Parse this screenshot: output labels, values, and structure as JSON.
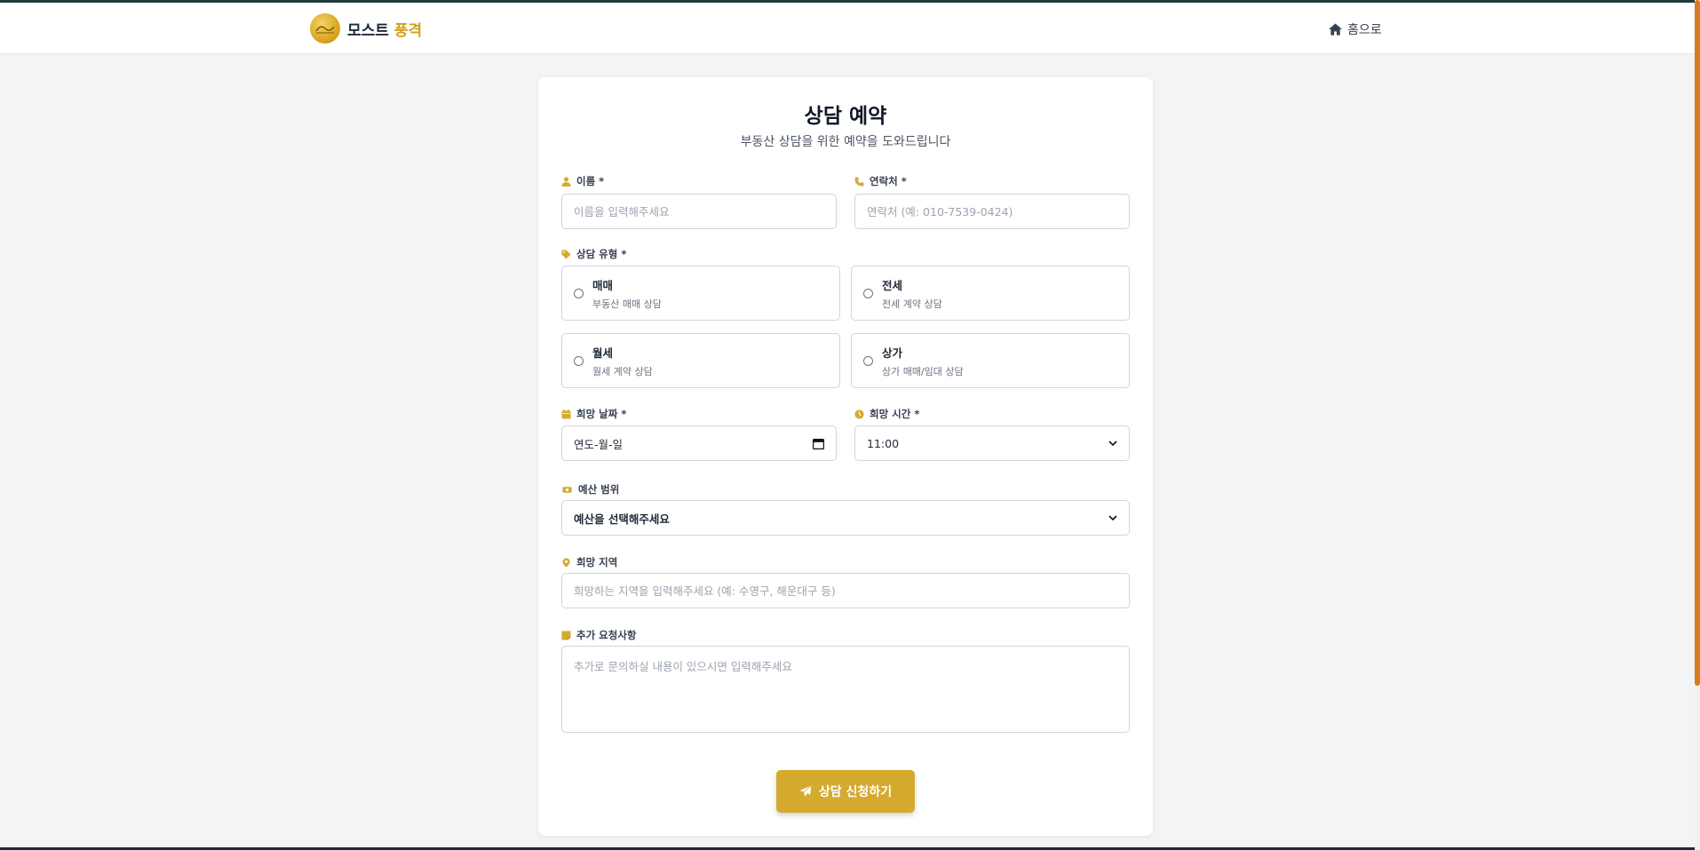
{
  "header": {
    "brand_main": "모스트",
    "brand_accent": "풍격",
    "home_label": "홈으로"
  },
  "form": {
    "title": "상담 예약",
    "subtitle": "부동산 상담을 위한 예약을 도와드립니다",
    "name": {
      "label": "이름 *",
      "placeholder": "이름을 입력해주세요"
    },
    "phone": {
      "label": "연락처 *",
      "placeholder": "연락처 (예: 010-7539-0424)"
    },
    "type": {
      "label": "상담 유형 *",
      "options": [
        {
          "title": "매매",
          "desc": "부동산 매매 상담"
        },
        {
          "title": "전세",
          "desc": "전세 계약 상담"
        },
        {
          "title": "월세",
          "desc": "월세 계약 상담"
        },
        {
          "title": "상가",
          "desc": "상가 매매/임대 상담"
        }
      ]
    },
    "date": {
      "label": "희망 날짜 *",
      "value": "연도-월-일"
    },
    "time": {
      "label": "희망 시간 *",
      "value": "11:00"
    },
    "budget": {
      "label": "예산 범위",
      "value": "예산을 선택해주세요"
    },
    "region": {
      "label": "희망 지역",
      "placeholder": "희망하는 지역을 입력해주세요 (예: 수영구, 해운대구 등)"
    },
    "notes": {
      "label": "추가 요청사항",
      "placeholder": "추가로 문의하실 내용이 있으시면 입력해주세요"
    },
    "submit_label": "상담 신청하기"
  },
  "colors": {
    "accent": "#d4aa2f",
    "scrollbar": "#d97a1f"
  },
  "icons": [
    "home-icon",
    "user-icon",
    "phone-icon",
    "tag-icon",
    "calendar-icon",
    "clock-icon",
    "money-icon",
    "location-icon",
    "note-icon",
    "send-icon"
  ]
}
